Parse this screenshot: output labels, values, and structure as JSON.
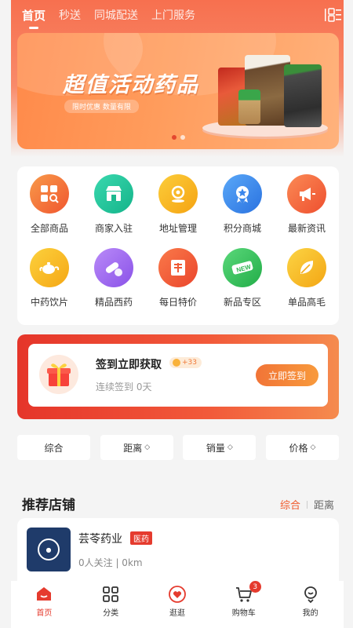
{
  "nav": {
    "tabs": [
      "首页",
      "秒送",
      "同城配送",
      "上门服务"
    ]
  },
  "banner": {
    "title": "超值活动药品",
    "subtitle": "限时优惠 数量有限"
  },
  "grid": [
    {
      "label": "全部商品",
      "color": "#f47a3a",
      "icon": "grid-search-icon"
    },
    {
      "label": "商家入驻",
      "color": "#22c39a",
      "icon": "store-icon"
    },
    {
      "label": "地址管理",
      "color": "#f9b323",
      "icon": "location-icon"
    },
    {
      "label": "积分商城",
      "color": "#3a8df0",
      "icon": "medal-icon"
    },
    {
      "label": "最新资讯",
      "color": "#f5673a",
      "icon": "megaphone-icon"
    },
    {
      "label": "中药饮片",
      "color": "#f9b323",
      "icon": "teapot-icon"
    },
    {
      "label": "精品西药",
      "color": "#9b6af0",
      "icon": "pill-icon"
    },
    {
      "label": "每日特价",
      "color": "#f06a3a",
      "icon": "tag-icon"
    },
    {
      "label": "新品专区",
      "color": "#33c05a",
      "icon": "new-icon"
    },
    {
      "label": "单品高毛",
      "color": "#f5b020",
      "icon": "leaf-icon"
    }
  ],
  "checkin": {
    "title": "签到立即获取",
    "points": "+33",
    "sub": "连续签到 0天",
    "button": "立即签到"
  },
  "filters": [
    "综合",
    "距离",
    "销量",
    "价格"
  ],
  "section": {
    "title": "推荐店铺",
    "sort_a": "综合",
    "sort_b": "距离"
  },
  "store": {
    "name": "芸苓药业",
    "tag": "医药",
    "meta": "0人关注 | 0km"
  },
  "tabbar": [
    {
      "label": "首页"
    },
    {
      "label": "分类"
    },
    {
      "label": "逛逛"
    },
    {
      "label": "购物车",
      "badge": "3"
    },
    {
      "label": "我的"
    }
  ]
}
